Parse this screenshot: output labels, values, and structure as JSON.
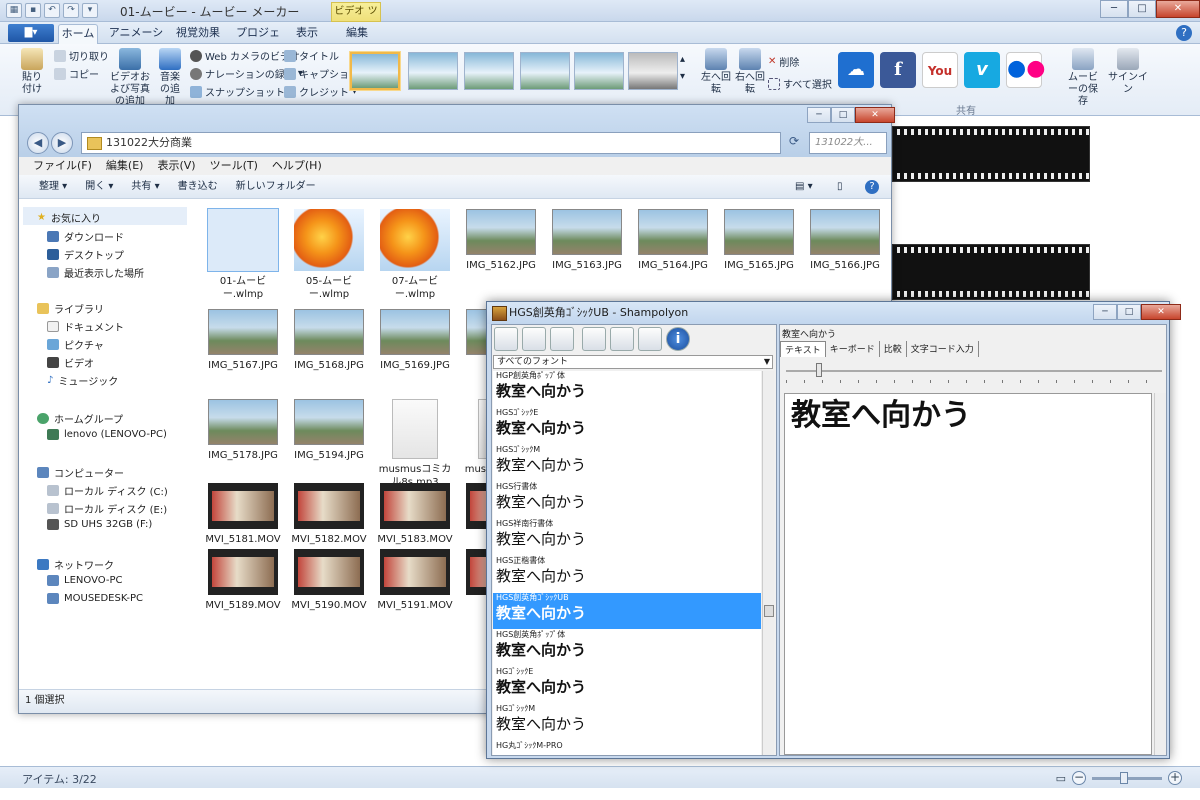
{
  "moviemaker": {
    "title": "01-ムービー - ムービー メーカー",
    "context_tab": "ビデオ ツール",
    "file_menu": "▇▾",
    "tabs": [
      "ホーム",
      "アニメーション",
      "視覚効果",
      "プロジェクト",
      "表示",
      "編集"
    ],
    "clipboard": {
      "paste": "貼り付け",
      "cut": "切り取り",
      "copy": "コピー"
    },
    "add": {
      "add_video": "ビデオおよび写真の追加",
      "add_music": "音楽の追加",
      "webcam": "Web カメラのビデオ",
      "narration": "ナレーションの録音",
      "snapshot": "スナップショット",
      "title": "タイトル",
      "caption": "キャプション",
      "credit": "クレジット"
    },
    "edit": {
      "rotate_left": "左へ回転",
      "rotate_right": "右へ回転",
      "delete": "削除",
      "select_all": "すべて選択"
    },
    "share": {
      "group_label": "共有",
      "save_movie": "ムービーの保存",
      "sign_in": "サインイン"
    },
    "status": {
      "items": "アイテム: 3/22"
    },
    "colors": {
      "accent": "#2f6fc2",
      "selected": "#3399ff"
    }
  },
  "explorer": {
    "address": "131022大分商業",
    "search_placeholder": "131022大...",
    "menu": [
      "ファイル(F)",
      "編集(E)",
      "表示(V)",
      "ツール(T)",
      "ヘルプ(H)"
    ],
    "toolbar": [
      "整理 ▾",
      "開く ▾",
      "共有 ▾",
      "書き込む",
      "新しいフォルダー"
    ],
    "sidebar": {
      "favorites": "お気に入り",
      "fav_items": [
        "ダウンロード",
        "デスクトップ",
        "最近表示した場所"
      ],
      "libraries": "ライブラリ",
      "lib_items": [
        "ドキュメント",
        "ピクチャ",
        "ビデオ",
        "ミュージック"
      ],
      "homegroup": "ホームグループ",
      "homegroup_items": [
        "lenovo (LENOVO-PC)"
      ],
      "computer": "コンピューター",
      "computer_items": [
        "ローカル ディスク (C:)",
        "ローカル ディスク (E:)",
        "SD UHS 32GB (F:)"
      ],
      "network": "ネットワーク",
      "network_items": [
        "LENOVO-PC",
        "MOUSEDESK-PC"
      ]
    },
    "files": [
      {
        "name": "01-ムービー.wlmp",
        "kind": "wlmp"
      },
      {
        "name": "05-ムービー.wlmp",
        "kind": "wlmp"
      },
      {
        "name": "07-ムービー.wlmp",
        "kind": "wlmp"
      },
      {
        "name": "IMG_5162.JPG",
        "kind": "photo"
      },
      {
        "name": "IMG_5163.JPG",
        "kind": "photo"
      },
      {
        "name": "IMG_5164.JPG",
        "kind": "photo"
      },
      {
        "name": "IMG_5165.JPG",
        "kind": "photo"
      },
      {
        "name": "IMG_5166.JPG",
        "kind": "photo"
      },
      {
        "name": "IMG_5167.JPG",
        "kind": "photo"
      },
      {
        "name": "IMG_5168.JPG",
        "kind": "photo"
      },
      {
        "name": "IMG_5169.JPG",
        "kind": "photo"
      },
      {
        "name": "IMG",
        "kind": "photo"
      },
      {
        "name": "IMG_5178.JPG",
        "kind": "photo"
      },
      {
        "name": "IMG_5194.JPG",
        "kind": "photo"
      },
      {
        "name": "musmusコミカル8s.mp3",
        "kind": "mp3"
      },
      {
        "name": "musmusコミカリー",
        "kind": "mp3"
      },
      {
        "name": "MVI_5181.MOV",
        "kind": "mov"
      },
      {
        "name": "MVI_5182.MOV",
        "kind": "mov"
      },
      {
        "name": "MVI_5183.MOV",
        "kind": "mov"
      },
      {
        "name": "MVI_",
        "kind": "mov"
      },
      {
        "name": "MVI_5189.MOV",
        "kind": "mov"
      },
      {
        "name": "MVI_5190.MOV",
        "kind": "mov"
      },
      {
        "name": "MVI_5191.MOV",
        "kind": "mov"
      },
      {
        "name": "MVI_",
        "kind": "mov"
      }
    ],
    "status": "1 個選択"
  },
  "shampolyon": {
    "title": "HGS創英角ｺﾞｼｯｸUB - Shampolyon",
    "filter": "すべてのフォント",
    "fonts": [
      {
        "name": "HGP創英角ﾎﾟｯﾌﾟ体",
        "sample": "教室へ向かう"
      },
      {
        "name": "HGSｺﾞｼｯｸE",
        "sample": "教室へ向かう"
      },
      {
        "name": "HGSｺﾞｼｯｸM",
        "sample": "教室へ向かう"
      },
      {
        "name": "HGS行書体",
        "sample": "教室へ向かう"
      },
      {
        "name": "HGS祥南行書体",
        "sample": "教室へ向かう"
      },
      {
        "name": "HGS正楷書体",
        "sample": "教室へ向かう"
      },
      {
        "name": "HGS創英角ｺﾞｼｯｸUB",
        "sample": "教室へ向かう"
      },
      {
        "name": "HGS創英角ﾎﾟｯﾌﾟ体",
        "sample": "教室へ向かう"
      },
      {
        "name": "HGｺﾞｼｯｸE",
        "sample": "教室へ向かう"
      },
      {
        "name": "HGｺﾞｼｯｸM",
        "sample": "教室へ向かう"
      },
      {
        "name": "HG丸ｺﾞｼｯｸM-PRO",
        "sample": ""
      }
    ],
    "selected_index": 6,
    "right": {
      "selected_text": "教室へ向かう",
      "tabs": [
        "テキスト",
        "キーボード",
        "比較",
        "文字コード入力"
      ],
      "preview": "教室へ向かう"
    }
  }
}
